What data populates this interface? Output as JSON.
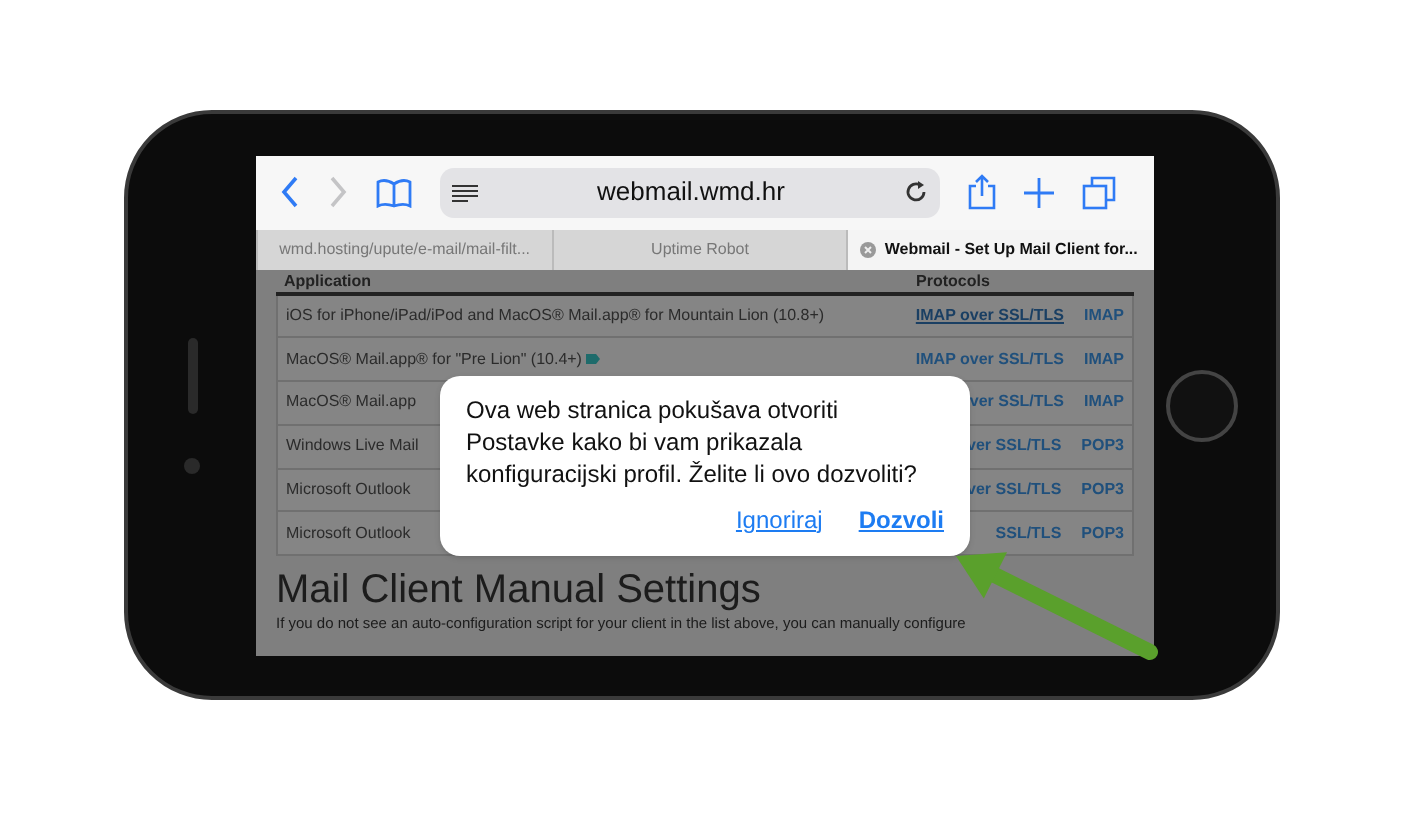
{
  "toolbar": {
    "back_disabled": false,
    "forward_disabled": true,
    "url": "webmail.wmd.hr"
  },
  "tabs": [
    {
      "label": "wmd.hosting/upute/e-mail/mail-filt...",
      "selected": false
    },
    {
      "label": "Uptime Robot",
      "selected": false
    },
    {
      "label": "Webmail - Set Up Mail Client for...",
      "selected": true
    }
  ],
  "table": {
    "columns": [
      "Application",
      "Protocols"
    ],
    "rows": [
      {
        "application": "iOS for iPhone/iPad/iPod and MacOS® Mail.app® for Mountain Lion (10.8+)",
        "protocol": "IMAP over SSL/TLS",
        "underlined": true,
        "protocol_2": "IMAP",
        "badge_icon": false
      },
      {
        "application": "MacOS® Mail.app® for \"Pre Lion\" (10.4+)",
        "protocol": "IMAP over SSL/TLS",
        "underlined": false,
        "protocol_2": "IMAP",
        "badge_icon": true
      },
      {
        "application": "MacOS® Mail.app",
        "protocol": "ver SSL/TLS",
        "underlined": false,
        "protocol_2": "IMAP",
        "badge_icon": false
      },
      {
        "application": "Windows Live Mail",
        "protocol": "ver SSL/TLS",
        "underlined": false,
        "protocol_2": "POP3",
        "badge_icon": false
      },
      {
        "application": "Microsoft Outlook",
        "protocol": "ver SSL/TLS",
        "underlined": false,
        "protocol_2": "POP3",
        "badge_icon": false
      },
      {
        "application": "Microsoft Outlook",
        "protocol": "SSL/TLS",
        "underlined": false,
        "protocol_2": "POP3",
        "badge_icon": false
      }
    ]
  },
  "heading": "Mail Client Manual Settings",
  "paragraph": "If you do not see an auto-configuration script for your client in the list above, you can manually configure",
  "dialog": {
    "message": "Ova web stranica pokušava otvoriti Postavke kako bi vam prikazala konfiguracijski profil. Želite li ovo dozvoliti?",
    "buttons": [
      "Ignoriraj",
      "Dozvoli"
    ]
  }
}
